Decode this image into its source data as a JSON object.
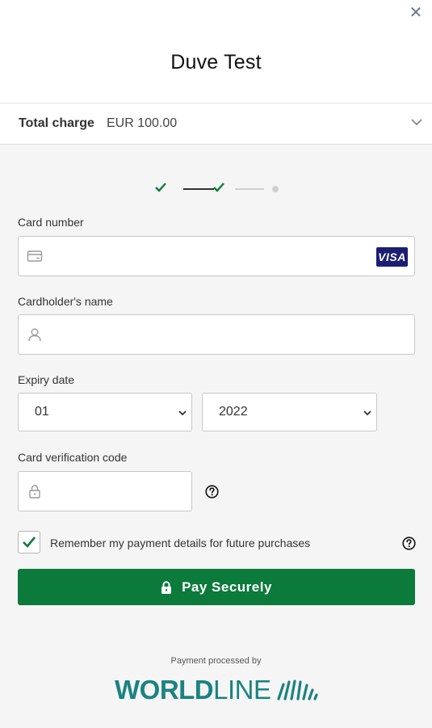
{
  "header": {
    "merchant_name": "Duve Test",
    "close_glyph": "✕"
  },
  "summary": {
    "total_label": "Total charge",
    "total_amount": "EUR 100.00"
  },
  "steps": {
    "completed": 2,
    "total": 3
  },
  "form": {
    "card_number": {
      "label": "Card number",
      "value": "",
      "placeholder": "",
      "brand": "VISA"
    },
    "cardholder_name": {
      "label": "Cardholder's name",
      "value": "",
      "placeholder": ""
    },
    "expiry": {
      "label": "Expiry date",
      "month": "01",
      "year": "2022"
    },
    "cvc": {
      "label": "Card verification code",
      "value": "",
      "placeholder": ""
    },
    "remember": {
      "label": "Remember my payment details for future purchases",
      "checked": true
    }
  },
  "pay_button": {
    "label": "Pay Securely"
  },
  "footer": {
    "processed_by": "Payment processed by",
    "logo_bold": "WORLD",
    "logo_light": "LINE"
  },
  "colors": {
    "primary_green": "#0b7a3a",
    "worldline_teal": "#1b8282",
    "visa_blue": "#1a1f71"
  }
}
